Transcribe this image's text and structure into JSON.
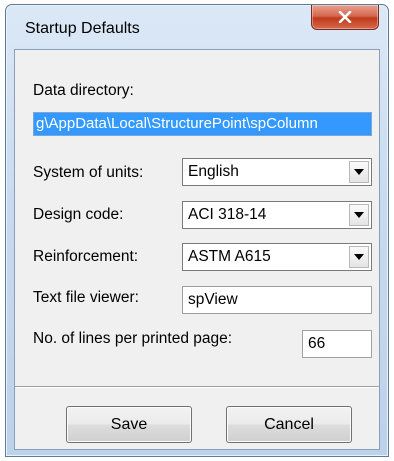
{
  "window": {
    "title": "Startup Defaults"
  },
  "fields": {
    "data_directory_label": "Data directory:",
    "data_directory_value": "g\\AppData\\Local\\StructurePoint\\spColumn",
    "units_label": "System of units:",
    "units_value": "English",
    "design_code_label": "Design code:",
    "design_code_value": "ACI 318-14",
    "reinforcement_label": "Reinforcement:",
    "reinforcement_value": "ASTM A615",
    "viewer_label": "Text file viewer:",
    "viewer_value": "spView",
    "lines_label": "No. of lines per printed page:",
    "lines_value": "66"
  },
  "buttons": {
    "save_label": "Save",
    "cancel_label": "Cancel"
  },
  "icons": {
    "close": "close-icon",
    "dropdown": "chevron-down-icon"
  },
  "colors": {
    "selection": "#3399ff",
    "close_button": "#c0391c"
  }
}
